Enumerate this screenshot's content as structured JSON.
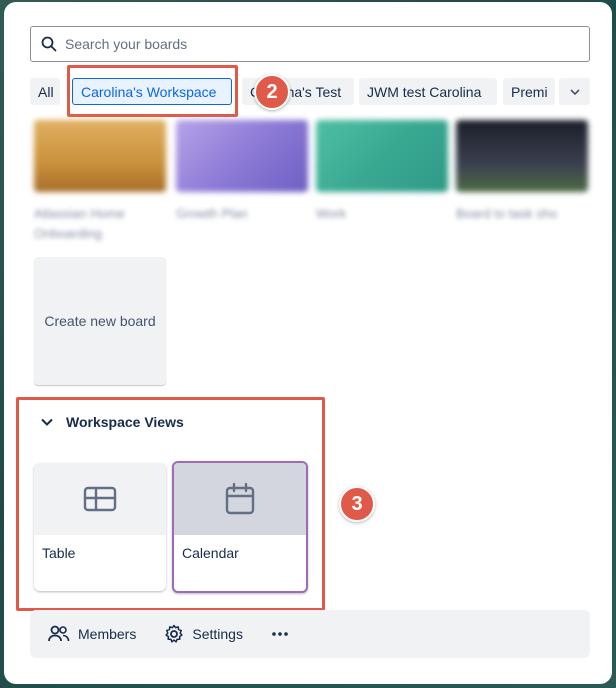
{
  "search": {
    "placeholder": "Search your boards"
  },
  "filters": {
    "chips": [
      "All",
      "Carolina's Workspace",
      "Carolina's Test",
      "JWM test Carolina",
      "Premi"
    ],
    "selected_index": 1
  },
  "annotations": {
    "badge_2": "2",
    "badge_3": "3",
    "color": "#e05a4a"
  },
  "boards": [
    {
      "name": "Atlassian Home Onboarding",
      "color": "#c9913b"
    },
    {
      "name": "Growth Plan",
      "color": "#8e7bd6"
    },
    {
      "name": "Work",
      "color": "#3aa992"
    },
    {
      "name": "Board to task sho",
      "color": "#2a2f3a"
    }
  ],
  "create_board": {
    "label": "Create new board"
  },
  "workspace_views": {
    "title": "Workspace Views",
    "items": [
      {
        "label": "Table",
        "icon": "table-icon"
      },
      {
        "label": "Calendar",
        "icon": "calendar-icon"
      }
    ]
  },
  "footer": {
    "members_label": "Members",
    "settings_label": "Settings",
    "more_icon": "more-icon"
  }
}
